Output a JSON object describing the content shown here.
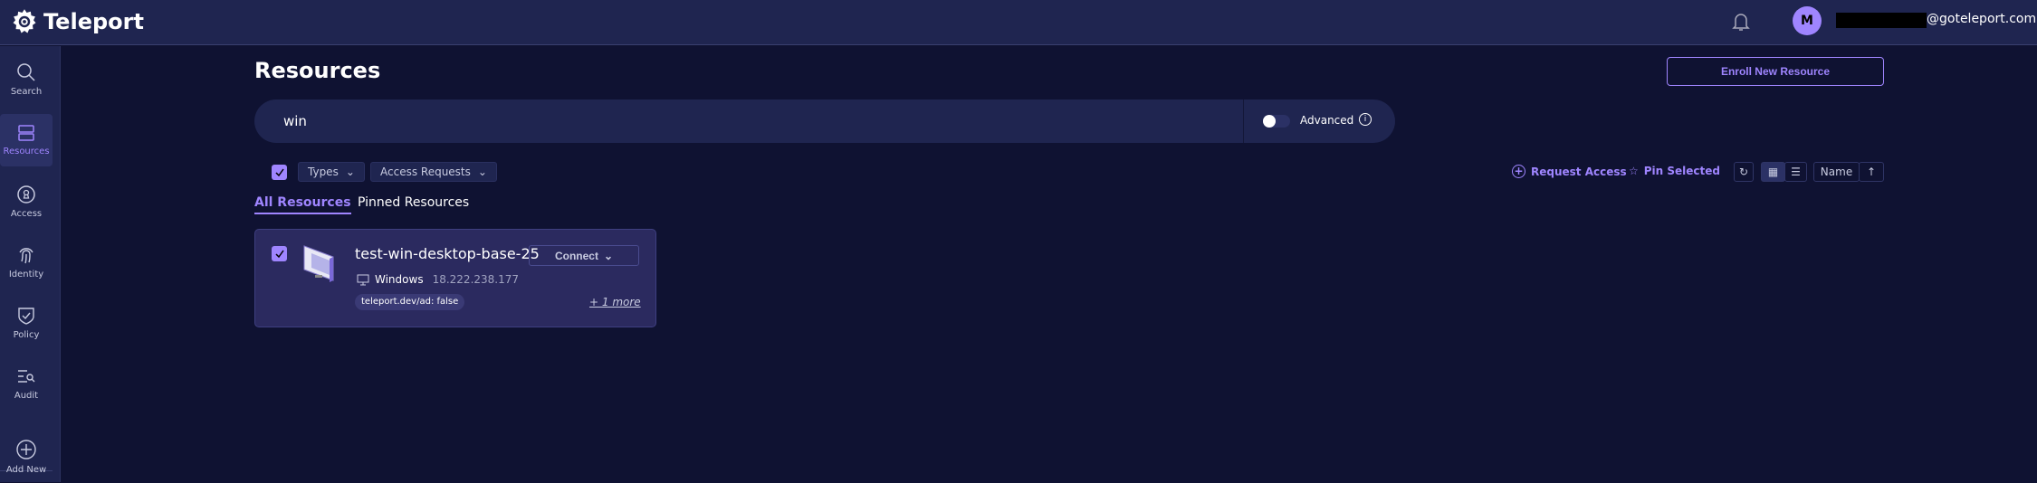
{
  "header": {
    "app_name": "Teleport",
    "avatar_initial": "M",
    "email_suffix": "@goteleport.com"
  },
  "sidebar": {
    "items": [
      {
        "label": "Search",
        "icon": "search-icon"
      },
      {
        "label": "Resources",
        "icon": "server-icon",
        "active": true
      },
      {
        "label": "Access",
        "icon": "keyhole-icon"
      },
      {
        "label": "Identity",
        "icon": "fingerprint-icon"
      },
      {
        "label": "Policy",
        "icon": "shield-check-icon"
      },
      {
        "label": "Audit",
        "icon": "list-search-icon"
      },
      {
        "label": "Add New",
        "icon": "plus-circle-icon"
      }
    ]
  },
  "main": {
    "title": "Resources",
    "enroll_label": "Enroll New Resource",
    "search": {
      "value": "win",
      "advanced_label": "Advanced",
      "advanced_enabled": false
    },
    "filters": {
      "types_label": "Types",
      "access_requests_label": "Access Requests",
      "select_all_checked": true
    },
    "actions": {
      "request_access": "Request Access",
      "pin_selected": "Pin Selected",
      "sort_label": "Name",
      "view": "card"
    },
    "tabs": [
      {
        "label": "All Resources",
        "active": true
      },
      {
        "label": "Pinned Resources"
      }
    ],
    "resources": [
      {
        "name": "test-win-desktop-base-25",
        "connect_label": "Connect",
        "os": "Windows",
        "address": "18.222.238.177",
        "labels": [
          "teleport.dev/ad: false"
        ],
        "more": "+ 1 more",
        "checked": true
      }
    ]
  },
  "colors": {
    "accent": "#9f85ff",
    "background": "#0f1232",
    "panel": "#1f2550",
    "card": "#2b2a5f"
  }
}
